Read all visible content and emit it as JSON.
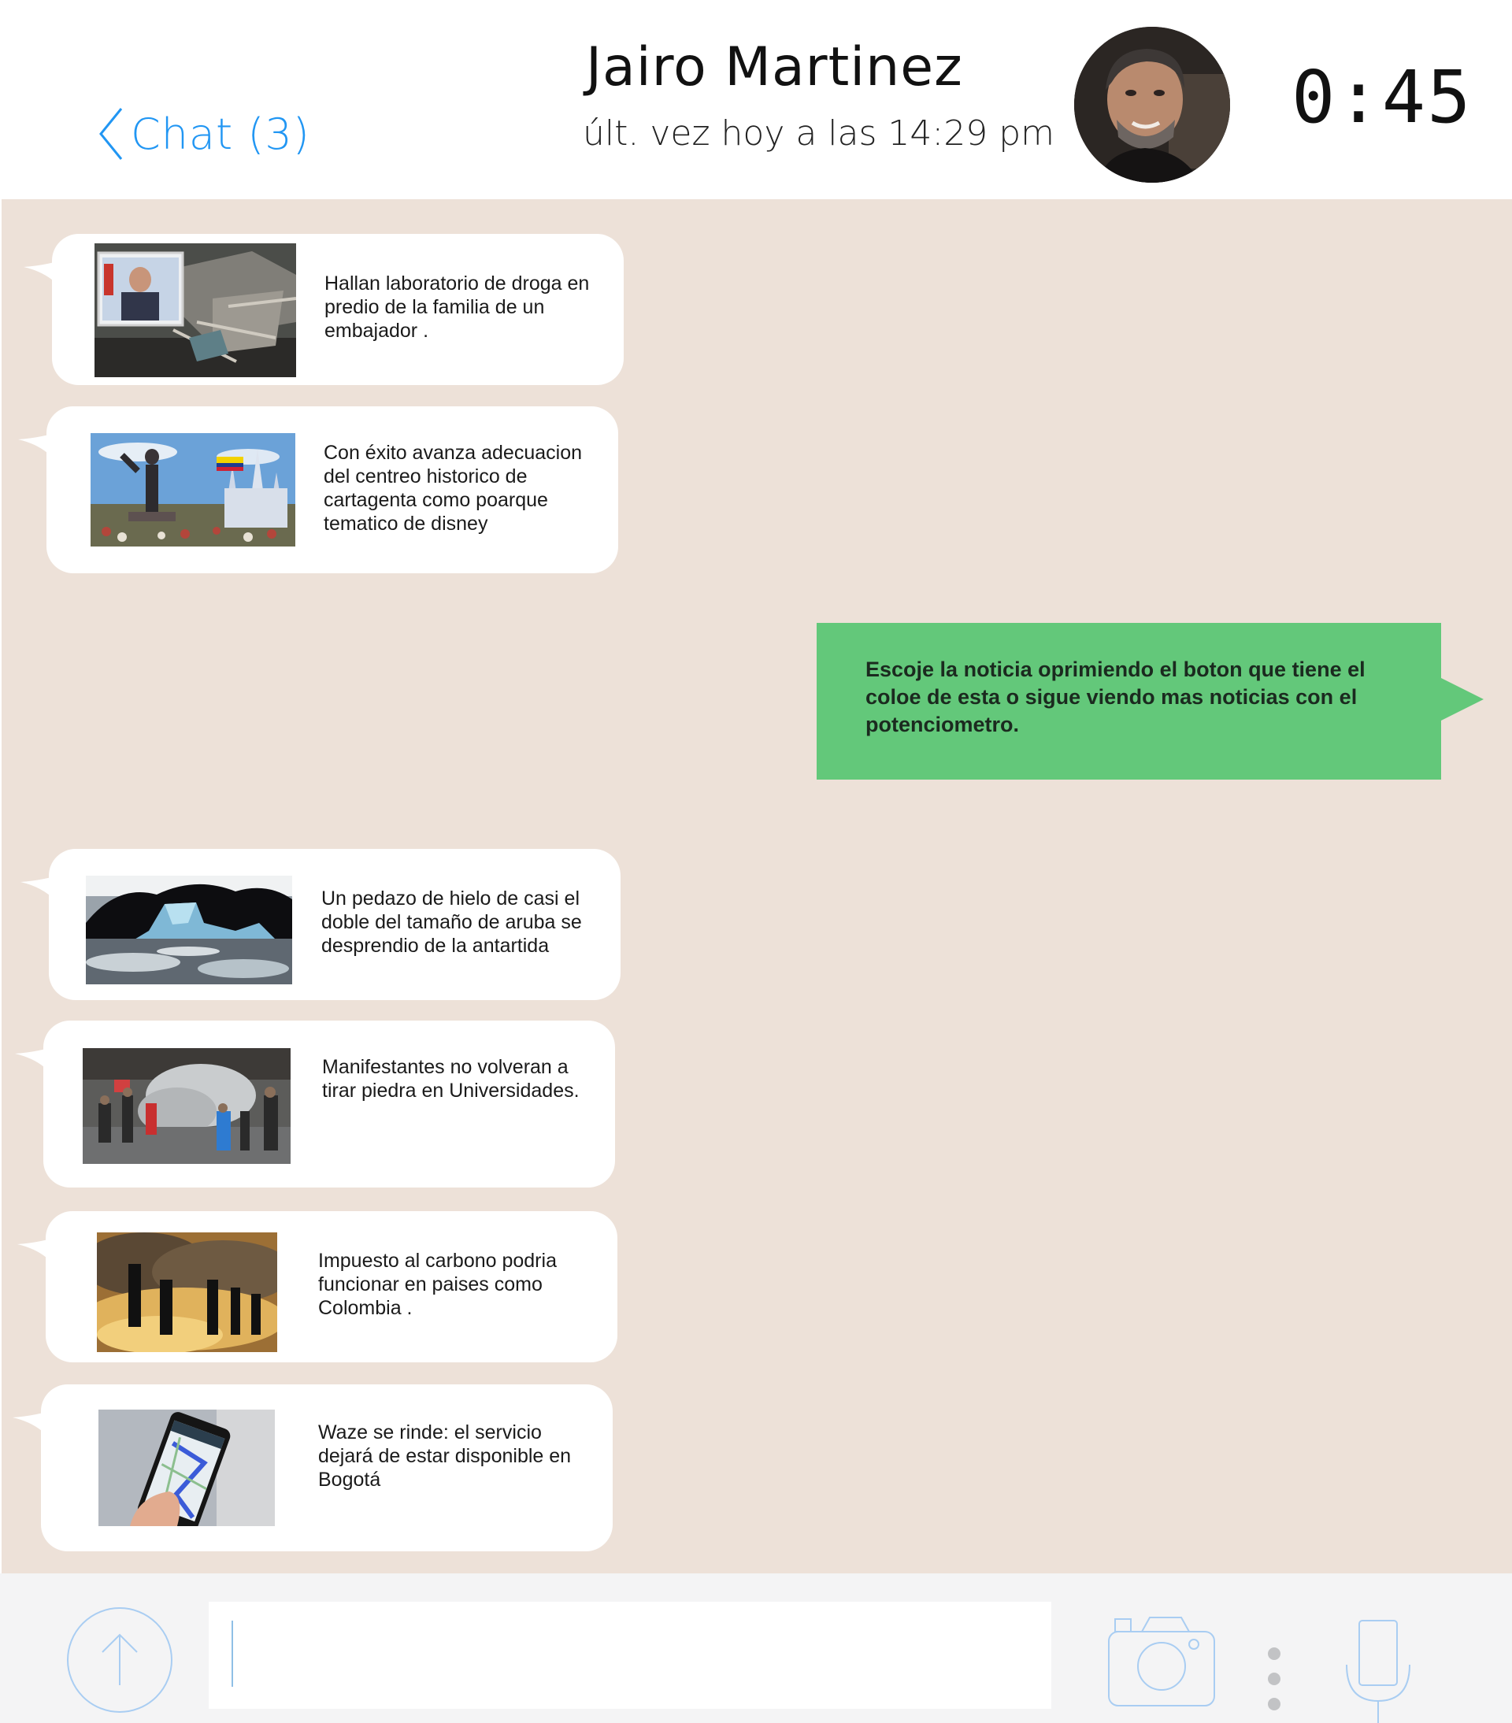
{
  "header": {
    "back_label": "Chat (3)",
    "contact_name": "Jairo Martinez",
    "last_seen": "últ. vez  hoy a las 14:29 pm",
    "timer": "0:45"
  },
  "messages": [
    {
      "text": "Hallan laboratorio  de droga en predio de la familia de un embajador .",
      "image": "drug-lab-raid-photo"
    },
    {
      "text": "Con éxito avanza adecuacion del centreo historico de cartagenta como poarque tematico de disney",
      "image": "disney-castle-photo"
    },
    {
      "text": "Un pedazo de hielo de casi el doble del tamaño de aruba se desprendio de la antartida",
      "image": "antarctic-ice-photo"
    },
    {
      "text": "Manifestantes no volveran a tirar piedra en Universidades.",
      "image": "protest-photo"
    },
    {
      "text": "Impuesto al carbono podria funcionar en paises como Colombia .",
      "image": "smokestacks-photo"
    },
    {
      "text": "Waze se rinde: el servicio dejará de estar disponible en Bogotá",
      "image": "waze-phone-photo"
    }
  ],
  "outgoing": {
    "text": "Escoje la noticia oprimiendo el boton que tiene el coloe de esta o sigue viendo mas noticias con el potenciometro."
  },
  "footer": {
    "input_value": "",
    "icons": [
      "upload-icon",
      "camera-icon",
      "more-dots-icon",
      "microphone-icon"
    ]
  },
  "colors": {
    "accent_blue": "#2196f3",
    "chat_background": "#ede1d8",
    "outgoing_bubble": "#63c87a",
    "footer_background": "#f4f4f5"
  }
}
